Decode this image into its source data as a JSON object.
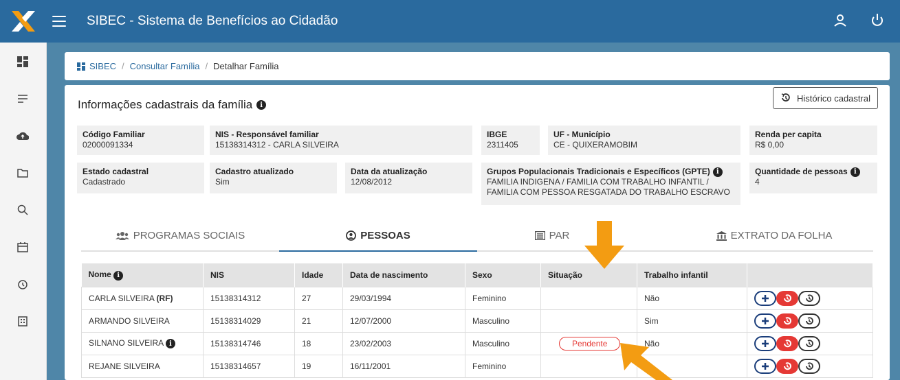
{
  "header": {
    "title": "SIBEC - Sistema de Benefícios ao Cidadão"
  },
  "icons": {
    "logo": "caixa-x-logo",
    "menu": "hamburger-icon",
    "user": "user-icon",
    "power": "power-icon",
    "sidebar": [
      "dashboard-icon",
      "list-icon",
      "cloud-upload-icon",
      "folder-icon",
      "search-icon",
      "calendar-icon",
      "alarm-icon",
      "building-icon"
    ]
  },
  "breadcrumb": {
    "home": "SIBEC",
    "level1": "Consultar Família",
    "current": "Detalhar Família"
  },
  "card": {
    "title": "Informações cadastrais da família",
    "history_button": "Histórico cadastral"
  },
  "fields": {
    "codigo_label": "Código Familiar",
    "codigo_value": "02000091334",
    "nis_label": "NIS - Responsável familiar",
    "nis_value": "15138314312 - CARLA SILVEIRA",
    "ibge_label": "IBGE",
    "ibge_value": "2311405",
    "uf_label": "UF - Município",
    "uf_value": "CE - QUIXERAMOBIM",
    "renda_label": "Renda per capita",
    "renda_value": "R$ 0,00",
    "estado_label": "Estado cadastral",
    "estado_value": "Cadastrado",
    "atualizado_label": "Cadastro atualizado",
    "atualizado_value": "Sim",
    "data_label": "Data da atualização",
    "data_value": "12/08/2012",
    "gpte_label": "Grupos Populacionais Tradicionais e Específicos (GPTE)",
    "gpte_value": "FAMILIA INDIGENA / FAMILIA COM TRABALHO INFANTIL / FAMILIA COM PESSOA RESGATADA DO TRABALHO ESCRAVO",
    "qtd_label": "Quantidade de pessoas",
    "qtd_value": "4"
  },
  "tabs": [
    {
      "label": "PROGRAMAS SOCIAIS",
      "icon": "users-icon"
    },
    {
      "label": "PESSOAS",
      "icon": "user-circle-icon"
    },
    {
      "label": "PAR",
      "icon": "list-alt-icon"
    },
    {
      "label": "EXTRATO DA FOLHA",
      "icon": "bank-icon"
    }
  ],
  "table": {
    "headers": [
      "Nome",
      "NIS",
      "Idade",
      "Data de nascimento",
      "Sexo",
      "Situação",
      "Trabalho infantil",
      ""
    ],
    "rows": [
      {
        "nome": "CARLA SILVEIRA",
        "rf": "(RF)",
        "nis": "15138314312",
        "idade": "27",
        "nasc": "29/03/1994",
        "sexo": "Feminino",
        "situacao": "",
        "trabalho": "Não"
      },
      {
        "nome": "ARMANDO SILVEIRA",
        "rf": "",
        "nis": "15138314029",
        "idade": "21",
        "nasc": "12/07/2000",
        "sexo": "Masculino",
        "situacao": "",
        "trabalho": "Sim"
      },
      {
        "nome": "SILNANO SILVEIRA",
        "rf": "",
        "nis": "15138314746",
        "idade": "18",
        "nasc": "23/02/2003",
        "sexo": "Masculino",
        "situacao": "Pendente",
        "trabalho": "Não"
      },
      {
        "nome": "REJANE SILVEIRA",
        "rf": "",
        "nis": "15138314657",
        "idade": "19",
        "nasc": "16/11/2001",
        "sexo": "Feminino",
        "situacao": "",
        "trabalho": ""
      }
    ]
  },
  "colors": {
    "header": "#2a6a9e",
    "accent_arrow": "#f39c12",
    "danger": "#e53935"
  }
}
